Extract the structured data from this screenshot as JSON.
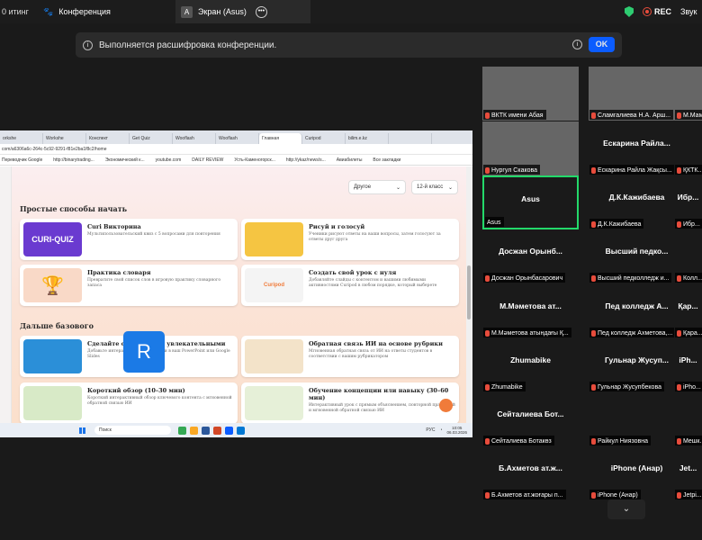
{
  "topbar": {
    "left_fragment": "0 итинг",
    "conference_title": "Конференция",
    "screen_tab_letter": "A",
    "screen_tab_title": "Экран (Asus)",
    "rec_label": "REC",
    "sound_label": "Звук"
  },
  "notice": {
    "text": "Выполняется расшифровка конференции.",
    "ok_label": "OK"
  },
  "browser": {
    "tabs": [
      "orkshe",
      "Workshe",
      "Конспект",
      "Get Quiz",
      "Wooflash",
      "Wooflash",
      "Главная",
      "Curipod",
      "bilim.e.kz",
      ""
    ],
    "active_tab_index": 6,
    "address": "com/a6306a6c-264c-5c92-9291-f81e2ba1f8c2/home",
    "bookmarks": [
      "Переводчик Google",
      "http://binarytrading...",
      "Экономический к...",
      "youtube.com",
      "DAILY REVIEW",
      "Усть-Каменогорск...",
      "http://ykaz/news/s...",
      "Авиабилеты",
      "Все закладки"
    ]
  },
  "page": {
    "filter_type": "Другое",
    "filter_grade": "12-й класс",
    "section1": "Простые способы начать",
    "section2": "Дальше базового",
    "cards": [
      {
        "title": "Curi Викторина",
        "desc": "Мультипользовательский квиз с 5 вопросами для повторения",
        "thumb_text": "CURI-QUIZ",
        "thumb_color": "#6a3ad0"
      },
      {
        "title": "Рисуй и голосуй",
        "desc": "Ученики рисуют ответы на ваши вопросы, затем голосуют за ответы друг друга",
        "thumb_text": "",
        "thumb_color": "#f5c542"
      },
      {
        "title": "Практика словаря",
        "desc": "Превратите свой список слов в игровую практику словарного запаса",
        "thumb_text": "",
        "thumb_color": "#f9d9c7"
      },
      {
        "title": "Создать свой урок с нуля",
        "desc": "Добавляйте слайды с контентом и вашими любимыми активностями Curipod в любом порядке, который выберете",
        "thumb_text": "Curipod",
        "thumb_color": "#f4f4f4"
      },
      {
        "title": "Сделайте свои слайды увлекательными",
        "desc": "Добавьте интерактивные активности в ваш PowerPoint или Google Slides",
        "thumb_text": "",
        "thumb_color": "#2b8fd8"
      },
      {
        "title": "Обратная связь ИИ на основе рубрики",
        "desc": "Мгновенная обратная связь от ИИ на ответы студентов в соответствии с вашим рубрикатором",
        "thumb_text": "",
        "thumb_color": "#f3e3c9"
      },
      {
        "title": "Короткий обзор (10–30 мин)",
        "desc": "Короткий интерактивный обзор ключевого контента с мгновенной обратной связью ИИ",
        "thumb_text": "",
        "thumb_color": "#d8eac7"
      },
      {
        "title": "Обучение концепции или навыку (30–60 мин)",
        "desc": "Интерактивный урок с прямым объяснением, повторной практикой и мгновенной обратной связью ИИ",
        "thumb_text": "",
        "thumb_color": "#e6f0d8"
      }
    ]
  },
  "taskbar": {
    "search_placeholder": "Поиск",
    "lang": "РУС",
    "time": "10:05",
    "date": "06.03.2026"
  },
  "participants": [
    {
      "label": "ВКТК имени Абая",
      "name": "",
      "video": true,
      "muted": true
    },
    {
      "label": "Сламгалиева Н.А. Арш...",
      "name": "",
      "video": true,
      "muted": true
    },
    {
      "label": "М.Мам...",
      "name": "",
      "video": true,
      "muted": true
    },
    {
      "label": "Нургул Скакова",
      "name": "",
      "video": true,
      "muted": true
    },
    {
      "label": "Ескарина Райла Жақсы...",
      "name": "Ескарина Райла...",
      "video": false,
      "muted": true
    },
    {
      "label": "ҚКТК...",
      "name": "",
      "video": false,
      "muted": true
    },
    {
      "label": "Asus",
      "name": "Asus",
      "video": false,
      "muted": false,
      "active": true
    },
    {
      "label": "Д.К.Кажибаева",
      "name": "Д.К.Кажибаева",
      "video": false,
      "muted": true
    },
    {
      "label": "Ибр...",
      "name": "Ибр...",
      "video": false,
      "muted": true
    },
    {
      "label": "Досжан Орынбасарович",
      "name": "Досжан Орынб...",
      "video": false,
      "muted": true
    },
    {
      "label": "Высший педколледж и...",
      "name": "Высший педко...",
      "video": false,
      "muted": true
    },
    {
      "label": "Колл...",
      "name": "",
      "video": false,
      "muted": true
    },
    {
      "label": "М.Мәметова атындағы Қ...",
      "name": "М.Мәметова ат...",
      "video": false,
      "muted": true
    },
    {
      "label": "Пед колледж Ахметова,...",
      "name": "Пед колледж А...",
      "video": false,
      "muted": true
    },
    {
      "label": "Қара...",
      "name": "Қар...",
      "video": false,
      "muted": true
    },
    {
      "label": "Zhumabike",
      "name": "Zhumabike",
      "video": false,
      "muted": true
    },
    {
      "label": "Гульнар Жусупбекова",
      "name": "Гульнар Жусуп...",
      "video": false,
      "muted": true
    },
    {
      "label": "iPho...",
      "name": "iPh...",
      "video": false,
      "muted": true
    },
    {
      "label": "Сейталиева Ботакөз",
      "name": "Сейталиева Бот...",
      "video": false,
      "muted": true
    },
    {
      "label": "Райкул Ниязовна",
      "name": "",
      "video": false,
      "muted": true,
      "avatar": "R"
    },
    {
      "label": "Мешк...",
      "name": "",
      "video": false,
      "muted": true
    },
    {
      "label": "Б.Ахметов ат.жоғары п...",
      "name": "Б.Ахметов ат.ж...",
      "video": false,
      "muted": true
    },
    {
      "label": "iPhone (Анар)",
      "name": "iPhone (Анар)",
      "video": false,
      "muted": true
    },
    {
      "label": "Jetpi...",
      "name": "Jet...",
      "video": false,
      "muted": true
    }
  ]
}
